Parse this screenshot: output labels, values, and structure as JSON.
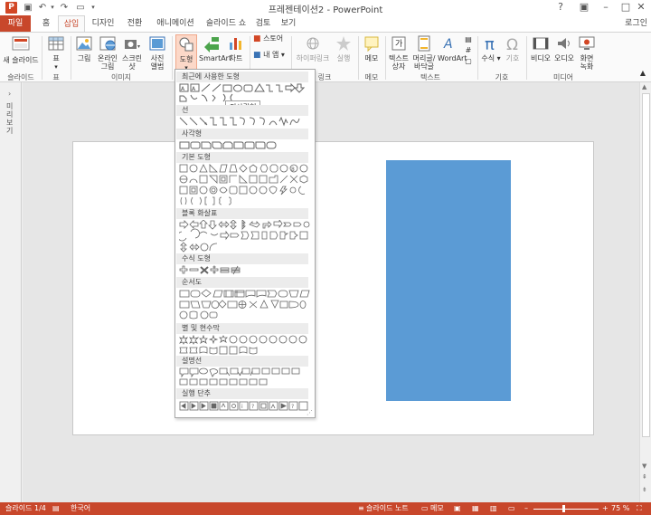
{
  "window": {
    "title": "프레젠테이션2 - PowerPoint",
    "app_icon": "P",
    "login": "로그인"
  },
  "qat": {
    "save": "▣",
    "undo": "↶",
    "redo": "↷",
    "present": "▭",
    "customize": "▾"
  },
  "tabs": [
    "홈",
    "삽입",
    "디자인",
    "전환",
    "애니메이션",
    "슬라이드 쇼",
    "검토",
    "보기"
  ],
  "file_tab": "파일",
  "ribbon": {
    "new_slide": "새 슬라이드",
    "table": "표",
    "image": "그림",
    "online_image": "온라인 그림",
    "screenshot": "스크린샷",
    "photo_album": "사진 앨범",
    "shapes": "도형",
    "smartart": "SmartArt",
    "chart": "차트",
    "store": "스토어",
    "my_apps": "내 앱",
    "hyperlink": "하이퍼링크",
    "action": "실행",
    "comment": "메모",
    "textbox": "텍스트 상자",
    "header_footer": "머리글/바닥글",
    "wordart": "WordArt",
    "equation": "수식",
    "symbol": "기호",
    "video": "비디오",
    "audio": "오디오",
    "screen_record": "화면 녹화",
    "groups": {
      "slides": "슬라이드",
      "tables": "표",
      "images": "이미지",
      "links": "링크",
      "comments": "메모",
      "text": "텍스트",
      "symbols": "기호",
      "media": "미디어"
    }
  },
  "shapes_menu": {
    "sections": [
      "최근에 사용한 도형",
      "선",
      "사각형",
      "기본 도형",
      "블록 화살표",
      "수식 도형",
      "순서도",
      "별 및 현수막",
      "설명선",
      "실행 단추"
    ],
    "tooltip": "직사각형"
  },
  "left_pane": {
    "label": "미리보기"
  },
  "status": {
    "slide": "슬라이드 1/4",
    "language": "한국어",
    "notes": "슬라이드 노트",
    "memo": "메모",
    "zoom": "75 %"
  },
  "colors": {
    "accent": "#c8472b",
    "shape_fill": "#5b9bd5"
  }
}
